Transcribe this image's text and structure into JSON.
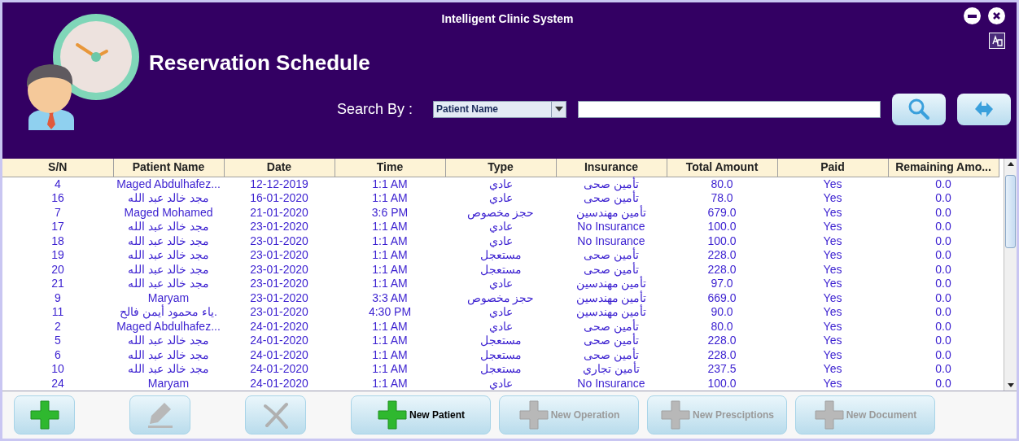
{
  "window": {
    "title": "Intelligent Clinic System"
  },
  "heading": "Reservation Schedule",
  "search": {
    "label": "Search By :",
    "field_by": "Patient Name"
  },
  "table": {
    "columns": [
      "S/N",
      "Patient Name",
      "Date",
      "Time",
      "Type",
      "Insurance",
      "Total Amount",
      "Paid",
      "Remaining Amo..."
    ],
    "rows": [
      [
        "4",
        "Maged Abdulhafez...",
        "12-12-2019",
        "1:1 AM",
        "عادي",
        "تأمين صحى",
        "80.0",
        "Yes",
        "0.0"
      ],
      [
        "16",
        "مجد خالد عبد الله",
        "16-01-2020",
        "1:1 AM",
        "عادي",
        "تأمين صحى",
        "78.0",
        "Yes",
        "0.0"
      ],
      [
        "7",
        "Maged Mohamed",
        "21-01-2020",
        "3:6 PM",
        "حجز مخصوص",
        "تأمين مهندسين",
        "679.0",
        "Yes",
        "0.0"
      ],
      [
        "17",
        "مجد خالد عبد الله",
        "23-01-2020",
        "1:1 AM",
        "عادي",
        "No Insurance",
        "100.0",
        "Yes",
        "0.0"
      ],
      [
        "18",
        "مجد خالد عبد الله",
        "23-01-2020",
        "1:1 AM",
        "عادي",
        "No Insurance",
        "100.0",
        "Yes",
        "0.0"
      ],
      [
        "19",
        "مجد خالد عبد الله",
        "23-01-2020",
        "1:1 AM",
        "مستعجل",
        "تأمين صحى",
        "228.0",
        "Yes",
        "0.0"
      ],
      [
        "20",
        "مجد خالد عبد الله",
        "23-01-2020",
        "1:1 AM",
        "مستعجل",
        "تأمين صحى",
        "228.0",
        "Yes",
        "0.0"
      ],
      [
        "21",
        "مجد خالد عبد الله",
        "23-01-2020",
        "1:1 AM",
        "عادي",
        "تأمين مهندسين",
        "97.0",
        "Yes",
        "0.0"
      ],
      [
        "9",
        "Maryam",
        "23-01-2020",
        "3:3 AM",
        "حجز مخصوص",
        "تأمين مهندسين",
        "669.0",
        "Yes",
        "0.0"
      ],
      [
        "11",
        "ياء محمود أيمن فالح.",
        "23-01-2020",
        "4:30 PM",
        "عادي",
        "تأمين مهندسين",
        "90.0",
        "Yes",
        "0.0"
      ],
      [
        "2",
        "Maged Abdulhafez...",
        "24-01-2020",
        "1:1 AM",
        "عادي",
        "تأمين صحى",
        "80.0",
        "Yes",
        "0.0"
      ],
      [
        "5",
        "مجد خالد عبد الله",
        "24-01-2020",
        "1:1 AM",
        "مستعجل",
        "تأمين صحى",
        "228.0",
        "Yes",
        "0.0"
      ],
      [
        "6",
        "مجد خالد عبد الله",
        "24-01-2020",
        "1:1 AM",
        "مستعجل",
        "تأمين صحى",
        "228.0",
        "Yes",
        "0.0"
      ],
      [
        "10",
        "مجد خالد عبد الله",
        "24-01-2020",
        "1:1 AM",
        "مستعجل",
        "تأمين تجاري",
        "237.5",
        "Yes",
        "0.0"
      ],
      [
        "24",
        "Maryam",
        "24-01-2020",
        "1:1 AM",
        "عادي",
        "No Insurance",
        "100.0",
        "Yes",
        "0.0"
      ]
    ]
  },
  "toolbar": [
    {
      "kind": "add",
      "disabled": false
    },
    {
      "kind": "edit",
      "disabled": true
    },
    {
      "kind": "delete",
      "disabled": true
    },
    {
      "kind": "add",
      "label": "New Patient",
      "disabled": false
    },
    {
      "kind": "add",
      "label": "New Operation",
      "disabled": true
    },
    {
      "kind": "add",
      "label": "New Presciptions",
      "disabled": true
    },
    {
      "kind": "add",
      "label": "New Document",
      "disabled": true
    }
  ]
}
